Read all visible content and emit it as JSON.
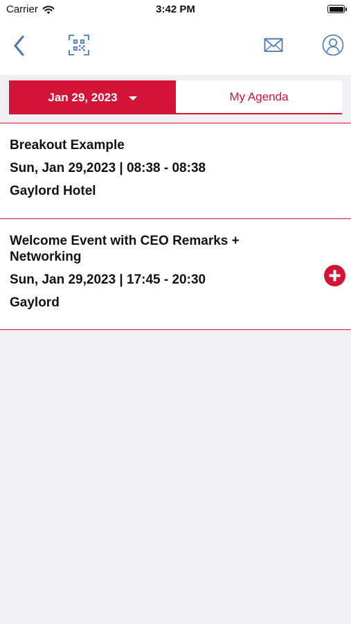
{
  "status_bar": {
    "carrier": "Carrier",
    "time": "3:42 PM"
  },
  "nav": {
    "back_icon": "chevron-left-icon",
    "qr_icon": "qr-scan-icon",
    "mail_icon": "envelope-icon",
    "profile_icon": "user-circle-icon"
  },
  "segmented": {
    "date_label": "Jan 29, 2023",
    "agenda_label": "My Agenda"
  },
  "sessions": [
    {
      "title": "Breakout Example",
      "time": "Sun, Jan 29,2023 | 08:38 - 08:38",
      "venue": "Gaylord Hotel"
    },
    {
      "title": "Welcome Event with CEO Remarks + Networking",
      "time": "Sun, Jan 29,2023 | 17:45 - 20:30",
      "venue": "Gaylord",
      "action_icon": "add-circle-icon"
    }
  ],
  "colors": {
    "accent": "#d21437",
    "nav_icon": "#4a79b3",
    "background": "#efeff4"
  }
}
